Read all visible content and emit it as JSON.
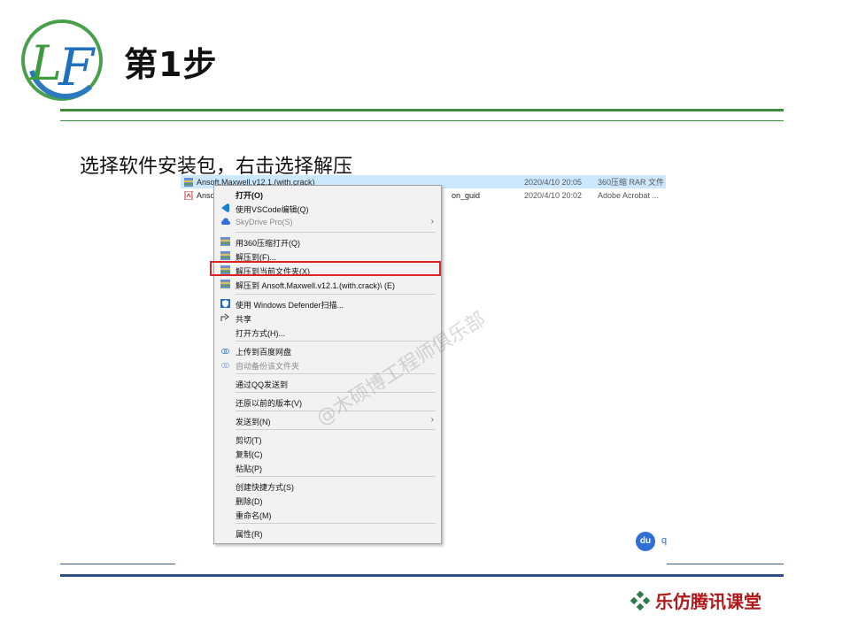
{
  "slide": {
    "title": "第1步",
    "instruction": "选择软件安装包，右击选择解压",
    "footer_brand": "乐仿腾讯课堂",
    "logo_text": "LF",
    "watermark": "@木硕博工程师俱乐部",
    "du_badge": "du",
    "du_suffix": "q"
  },
  "files": [
    {
      "name": "Ansoft.Maxwell.v12.1.(with.crack)",
      "date": "2020/4/10 20:05",
      "type": "360压缩 RAR 文件",
      "selected": true,
      "icon": "rar-archive-icon"
    },
    {
      "name": "Ansof",
      "name_tail": "on_guid",
      "date": "2020/4/10 20:02",
      "type": "Adobe Acrobat ...",
      "selected": false,
      "icon": "pdf-icon"
    }
  ],
  "context_menu": {
    "items": [
      {
        "label": "打开(O)",
        "bold": true
      },
      {
        "label": "使用VSCode编辑(Q)",
        "icon": "vscode-icon"
      },
      {
        "label": "SkyDrive Pro(S)",
        "icon": "cloud-icon",
        "disabled": true,
        "submenu": true
      },
      {
        "label": "用360压缩打开(Q)",
        "icon": "archive-icon"
      },
      {
        "label": "解压到(F)...",
        "icon": "archive-icon"
      },
      {
        "label": "解压到当前文件夹(X)",
        "icon": "archive-icon",
        "highlighted": true
      },
      {
        "label": "解压到 Ansoft.Maxwell.v12.1.(with.crack)\\ (E)",
        "icon": "archive-icon"
      },
      {
        "label": "使用 Windows Defender扫描...",
        "icon": "shield-icon"
      },
      {
        "label": "共享",
        "icon": "share-icon"
      },
      {
        "label": "打开方式(H)..."
      },
      {
        "label": "上传到百度网盘",
        "icon": "baidu-cloud-icon"
      },
      {
        "label": "自动备份该文件夹",
        "icon": "baidu-cloud-icon",
        "disabled": true
      },
      {
        "label": "通过QQ发送到"
      },
      {
        "label": "还原以前的版本(V)"
      },
      {
        "label": "发送到(N)",
        "submenu": true
      },
      {
        "label": "剪切(T)"
      },
      {
        "label": "复制(C)"
      },
      {
        "label": "粘贴(P)"
      },
      {
        "label": "创建快捷方式(S)"
      },
      {
        "label": "删除(D)"
      },
      {
        "label": "重命名(M)"
      },
      {
        "label": "属性(R)"
      }
    ]
  },
  "colors": {
    "accent_green": "#3e8b3e",
    "accent_blue": "#2d4f86",
    "highlight_red": "#dd2222",
    "brand_red": "#b11a1a"
  }
}
